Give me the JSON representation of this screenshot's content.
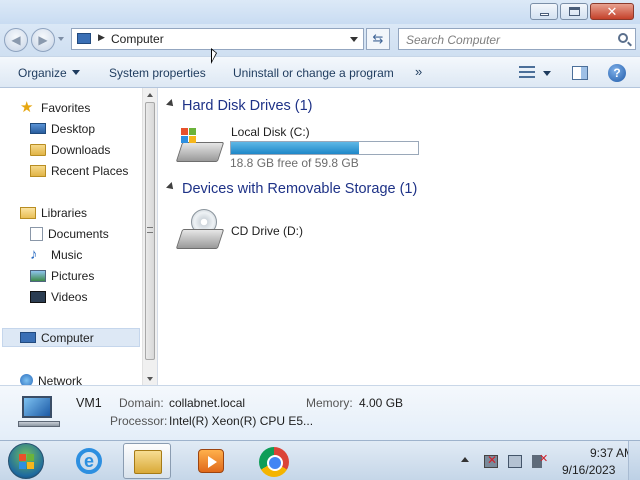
{
  "window": {
    "close_glyph": "✕"
  },
  "address": {
    "path": "Computer",
    "search_placeholder": "Search Computer"
  },
  "toolbar": {
    "organize": "Organize",
    "system_properties": "System properties",
    "uninstall": "Uninstall or change a program",
    "more": "»"
  },
  "nav": {
    "favorites": "Favorites",
    "desktop": "Desktop",
    "downloads": "Downloads",
    "recent_places": "Recent Places",
    "libraries": "Libraries",
    "documents": "Documents",
    "music": "Music",
    "pictures": "Pictures",
    "videos": "Videos",
    "computer": "Computer",
    "network": "Network"
  },
  "groups": {
    "hdd": "Hard Disk Drives (1)",
    "removable": "Devices with Removable Storage (1)"
  },
  "drives": {
    "local_name": "Local Disk (C:)",
    "local_free": "18.8 GB free of 59.8 GB",
    "local_used_fraction": 0.686,
    "cd_name": "CD Drive (D:)"
  },
  "details": {
    "computer_name": "VM1",
    "domain_label": "Domain:",
    "domain_value": "collabnet.local",
    "memory_label": "Memory:",
    "memory_value": "4.00 GB",
    "processor_label": "Processor:",
    "processor_value": "Intel(R) Xeon(R) CPU E5..."
  },
  "clock": {
    "time": "9:37 AM",
    "date": "9/16/2023"
  },
  "colors": {
    "accent": "#1e3287",
    "bar_fill": "#1e87c8",
    "titlebar": "#dce9f7"
  },
  "icons": {
    "back": "back-arrow-icon",
    "forward": "forward-arrow-icon",
    "refresh": "refresh-icon",
    "search": "search-icon",
    "help": "help-icon"
  }
}
